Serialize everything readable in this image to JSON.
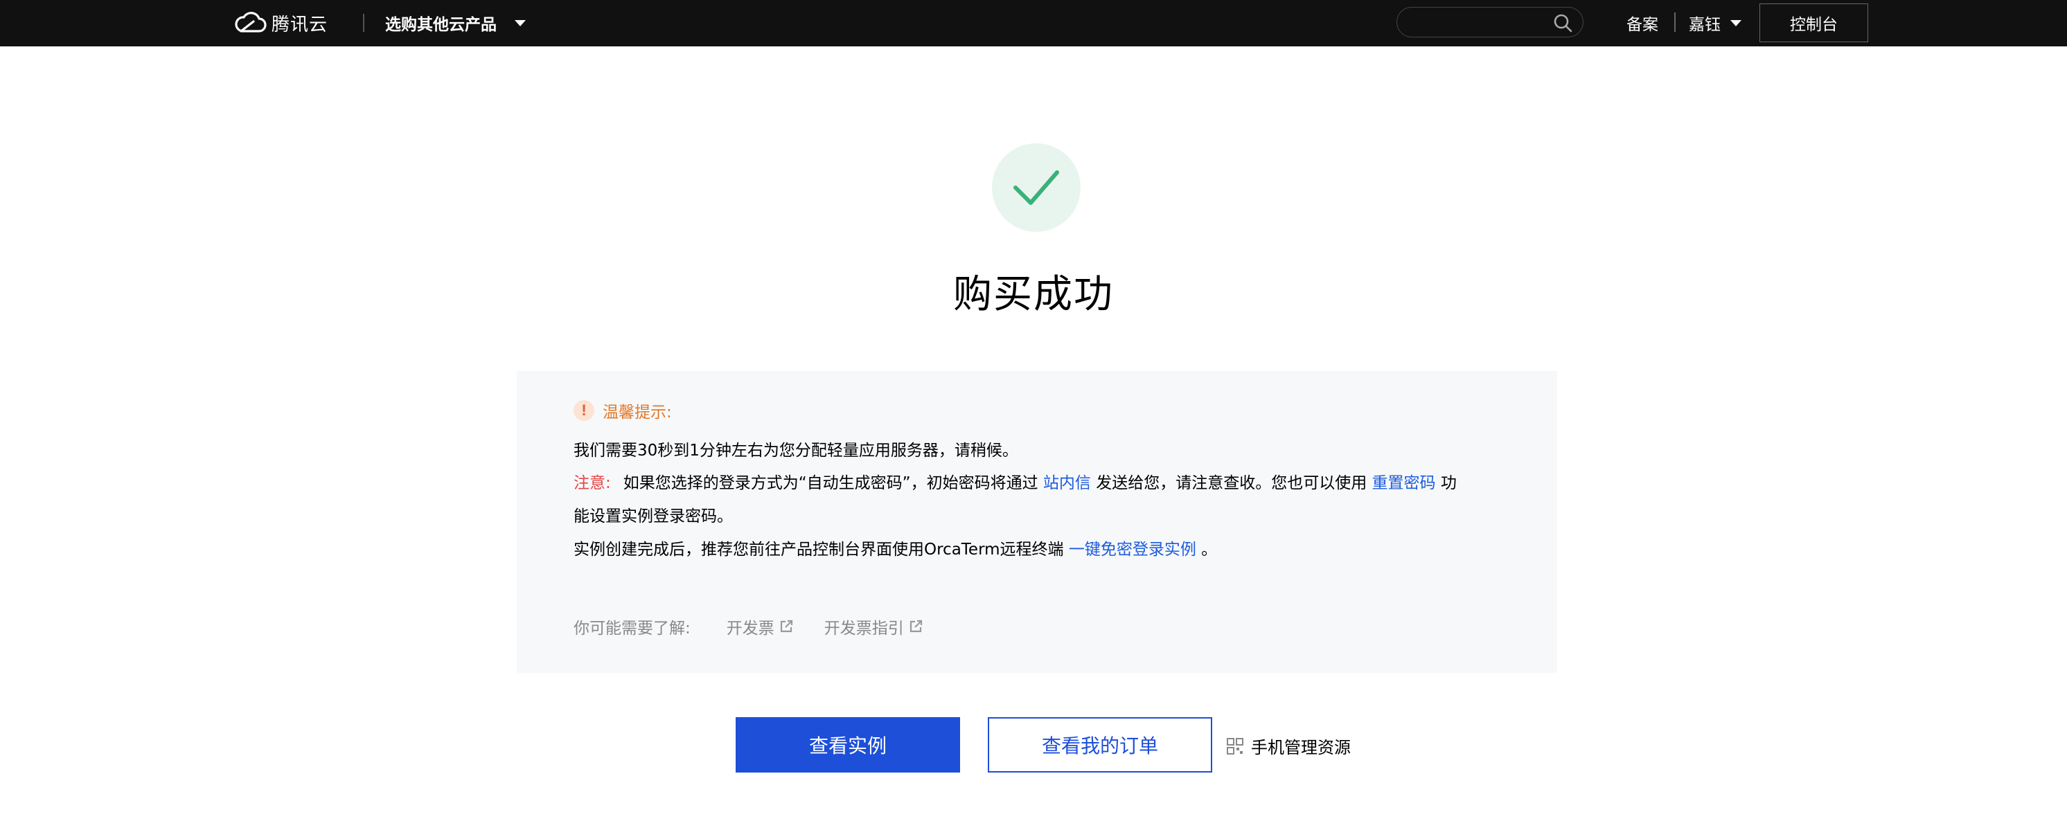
{
  "nav": {
    "brand": "腾讯云",
    "products_menu": "选购其他云产品",
    "search_placeholder": "",
    "beian": "备案",
    "user": "嘉钰",
    "console": "控制台"
  },
  "result": {
    "title": "购买成功"
  },
  "tip": {
    "heading": "温馨提示:",
    "line1": "我们需要30秒到1分钟左右为您分配轻量应用服务器，请稍候。",
    "notice_label": "注意:",
    "line2_before": "如果您选择的登录方式为“自动生成密码”，初始密码将通过",
    "line2_link1": "站内信",
    "line2_mid": "发送给您，请注意查收。您也可以使用",
    "line2_link2": "重置密码",
    "line2_end": "功",
    "line3": "能设置实例登录密码。",
    "line4_before": "实例创建完成后，推荐您前往产品控制台界面使用OrcaTerm远程终端",
    "line4_link": "一键免密登录实例",
    "line4_end": "。",
    "learn_label": "你可能需要了解:",
    "learn_links": [
      "开发票",
      "开发票指引"
    ]
  },
  "actions": {
    "view_instance": "查看实例",
    "view_orders": "查看我的订单",
    "mobile_manage": "手机管理资源"
  },
  "colors": {
    "nav_bg": "#111111",
    "primary": "#1d4fd8",
    "success": "#3bb07a",
    "warning": "#e0792a",
    "danger": "#e54545",
    "link": "#1d5bdc"
  },
  "icons": {
    "logo": "tencent-cloud-logo",
    "search": "search-icon",
    "success": "check-icon",
    "tip": "exclamation-icon",
    "external": "external-link-icon",
    "mobile": "qr-code-icon"
  }
}
